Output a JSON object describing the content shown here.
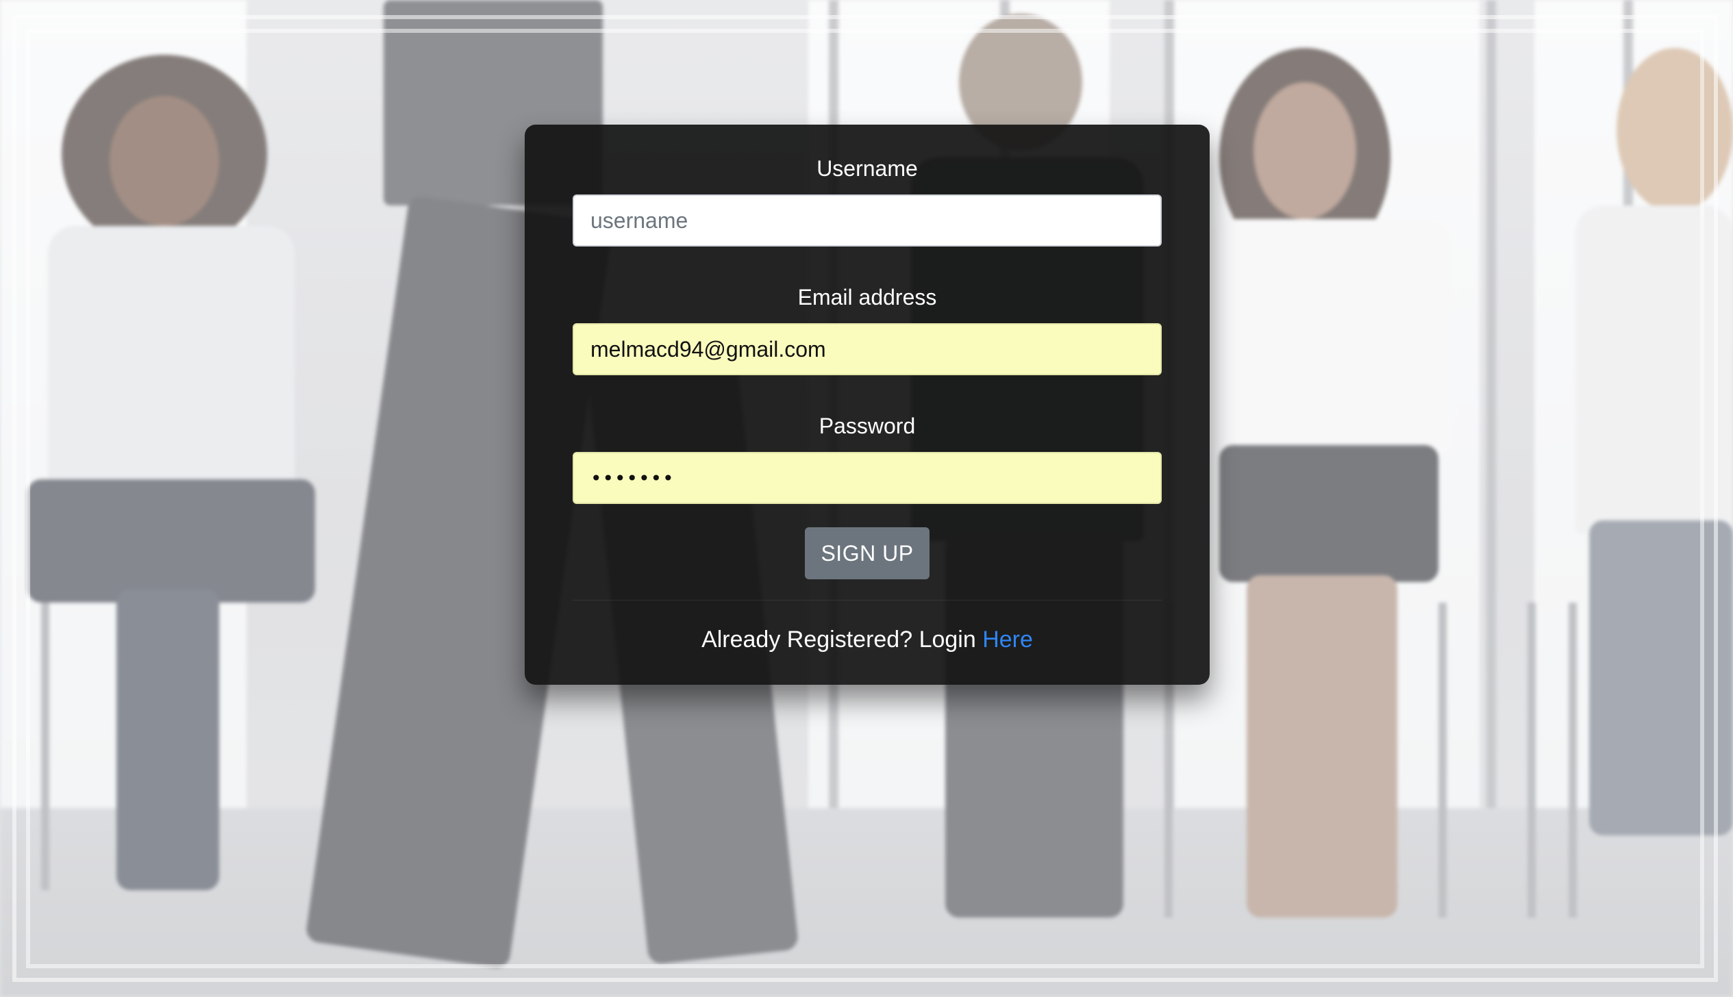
{
  "form": {
    "username_label": "Username",
    "username_placeholder": "username",
    "username_value": "",
    "email_label": "Email address",
    "email_value": "melmacd94@gmail.com",
    "password_label": "Password",
    "password_value": "•••••••",
    "submit_label": "SIGN UP"
  },
  "footer": {
    "prompt": "Already Registered? Login",
    "link_label": "Here"
  },
  "colors": {
    "card_background": "#121212",
    "autofill_background": "#fafcbd",
    "button_background": "#6c757d",
    "link": "#2f86f6"
  }
}
